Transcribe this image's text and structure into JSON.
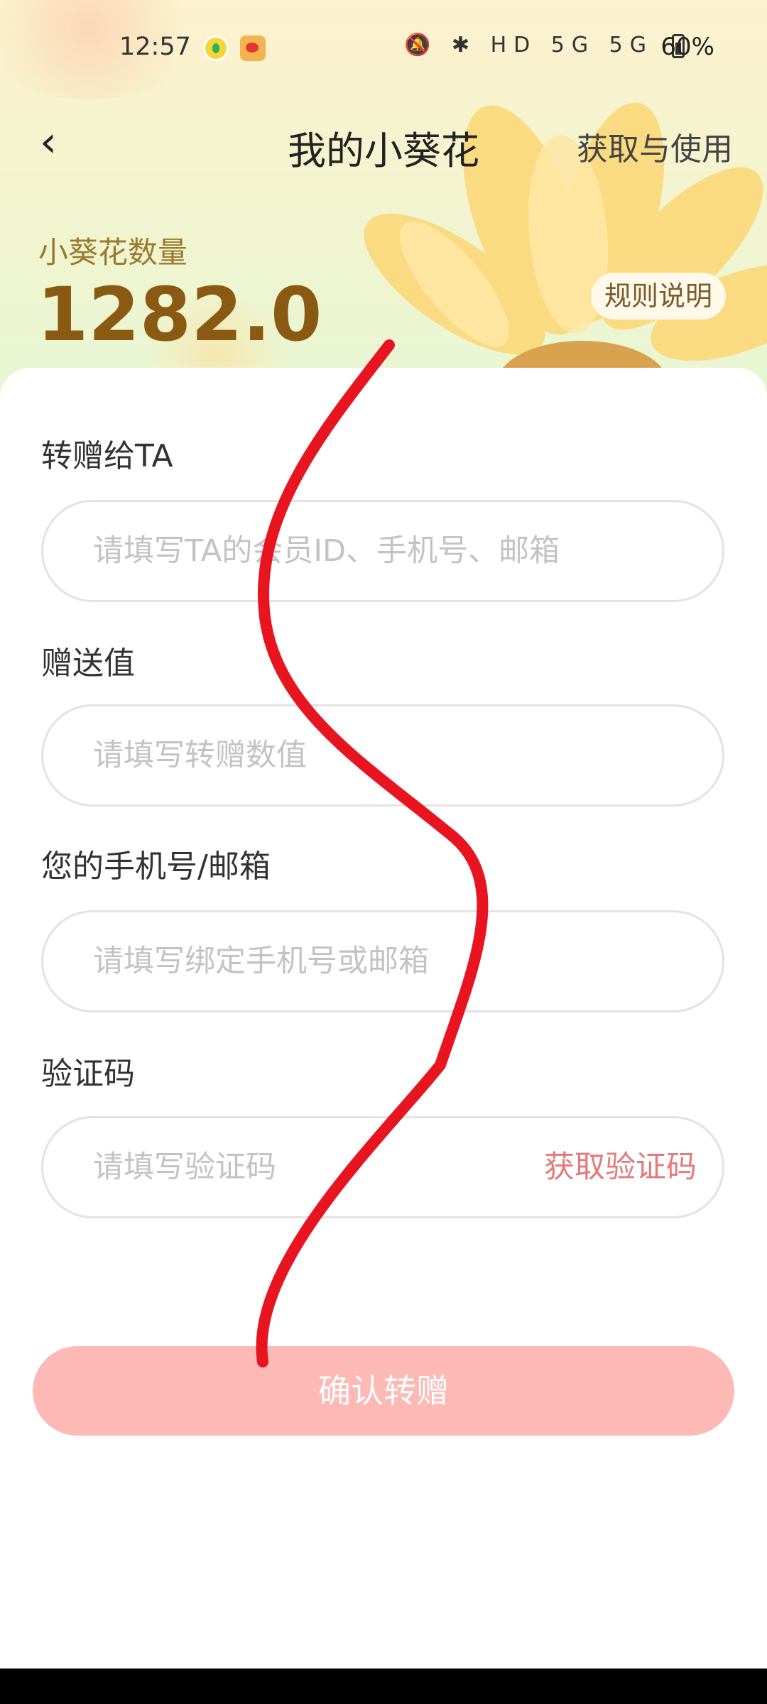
{
  "status_bar": {
    "time": "12:57",
    "signal_icons": "🔕 ✱ HD 5G 5G",
    "battery_percent": "60%"
  },
  "nav": {
    "back_icon": "chevron-left-icon",
    "back_glyph": "‹",
    "title": "我的小葵花",
    "right_link": "获取与使用"
  },
  "summary": {
    "label": "小葵花数量",
    "value": "1282.0",
    "rules_button": "规则说明"
  },
  "form": {
    "recipient": {
      "label": "转赠给TA",
      "placeholder": "请填写TA的会员ID、手机号、邮箱"
    },
    "amount": {
      "label": "赠送值",
      "placeholder": "请填写转赠数值"
    },
    "contact": {
      "label": "您的手机号/邮箱",
      "placeholder": "请填写绑定手机号或邮箱"
    },
    "code": {
      "label": "验证码",
      "placeholder": "请填写验证码",
      "action": "获取验证码"
    }
  },
  "confirm_button": "确认转赠",
  "colors": {
    "accent": "#e57a7a",
    "confirm_bg": "#fdb9b6",
    "count_value": "#8b5a12",
    "annotation_stroke": "#e8141f"
  }
}
